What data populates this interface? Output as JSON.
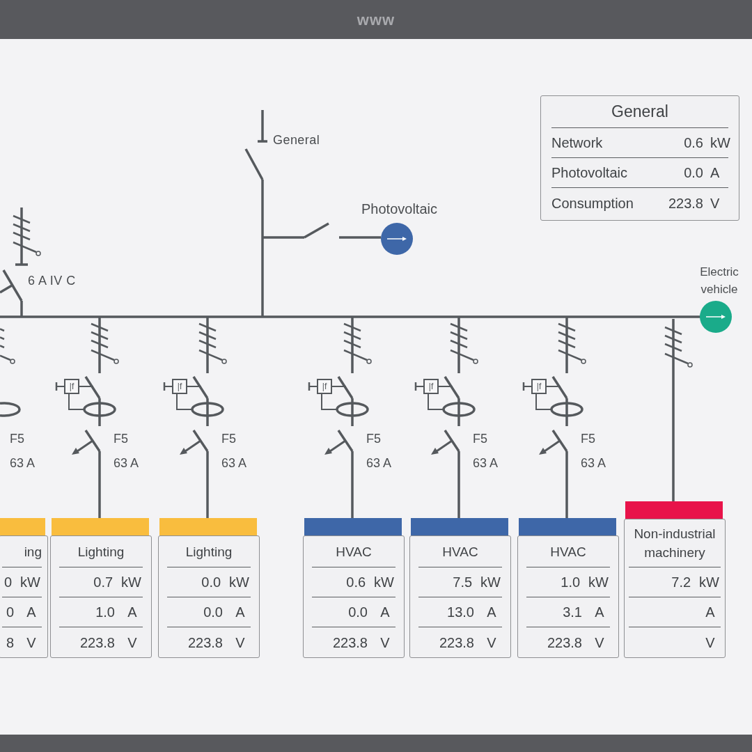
{
  "browser_bar": {
    "title": "www"
  },
  "diagram": {
    "main_switch": {
      "label": "General"
    },
    "source": {
      "label": "Photovoltaic"
    },
    "ev_output": {
      "label": "Electric vehicle"
    },
    "incomer_breaker": {
      "label": "6 A IV C"
    }
  },
  "general_panel": {
    "title": "General",
    "rows": [
      {
        "label": "Network",
        "value": "0.6",
        "unit": "kW"
      },
      {
        "label": "Photovoltaic",
        "value": "0.0",
        "unit": "A"
      },
      {
        "label": "Consumption",
        "value": "223.8",
        "unit": "V"
      }
    ]
  },
  "feeders": [
    {
      "kind": "rcd",
      "fuse": "F5",
      "rating": "63 A",
      "color": "#f9bd3e",
      "card": {
        "title": "ing",
        "rows": [
          {
            "value": "0",
            "unit": "kW"
          },
          {
            "value": "0",
            "unit": "A"
          },
          {
            "value": "8",
            "unit": "V"
          }
        ]
      }
    },
    {
      "kind": "rcd",
      "relay_label": "|f",
      "fuse": "F5",
      "rating": "63 A",
      "color": "#f9bd3e",
      "card": {
        "title": "Lighting",
        "rows": [
          {
            "value": "0.7",
            "unit": "kW"
          },
          {
            "value": "1.0",
            "unit": "A"
          },
          {
            "value": "223.8",
            "unit": "V"
          }
        ]
      }
    },
    {
      "kind": "rcd",
      "relay_label": "|f",
      "fuse": "F5",
      "rating": "63 A",
      "color": "#f9bd3e",
      "card": {
        "title": "Lighting",
        "rows": [
          {
            "value": "0.0",
            "unit": "kW"
          },
          {
            "value": "0.0",
            "unit": "A"
          },
          {
            "value": "223.8",
            "unit": "V"
          }
        ]
      }
    },
    {
      "kind": "rcd",
      "relay_label": "|f",
      "fuse": "F5",
      "rating": "63 A",
      "color": "#3e67a8",
      "card": {
        "title": "HVAC",
        "rows": [
          {
            "value": "0.6",
            "unit": "kW"
          },
          {
            "value": "0.0",
            "unit": "A"
          },
          {
            "value": "223.8",
            "unit": "V"
          }
        ]
      }
    },
    {
      "kind": "rcd",
      "relay_label": "|f",
      "fuse": "F5",
      "rating": "63 A",
      "color": "#3e67a8",
      "card": {
        "title": "HVAC",
        "rows": [
          {
            "value": "7.5",
            "unit": "kW"
          },
          {
            "value": "13.0",
            "unit": "A"
          },
          {
            "value": "223.8",
            "unit": "V"
          }
        ]
      }
    },
    {
      "kind": "rcd",
      "relay_label": "|f",
      "fuse": "F5",
      "rating": "63 A",
      "color": "#3e67a8",
      "card": {
        "title": "HVAC",
        "rows": [
          {
            "value": "1.0",
            "unit": "kW"
          },
          {
            "value": "3.1",
            "unit": "A"
          },
          {
            "value": "223.8",
            "unit": "V"
          }
        ]
      }
    },
    {
      "kind": "direct",
      "color": "#e8134a",
      "card": {
        "title": "Non-industrial machinery",
        "rows": [
          {
            "value": "7.2",
            "unit": "kW"
          },
          {
            "unit": "A"
          },
          {
            "unit": "V"
          }
        ]
      }
    }
  ]
}
